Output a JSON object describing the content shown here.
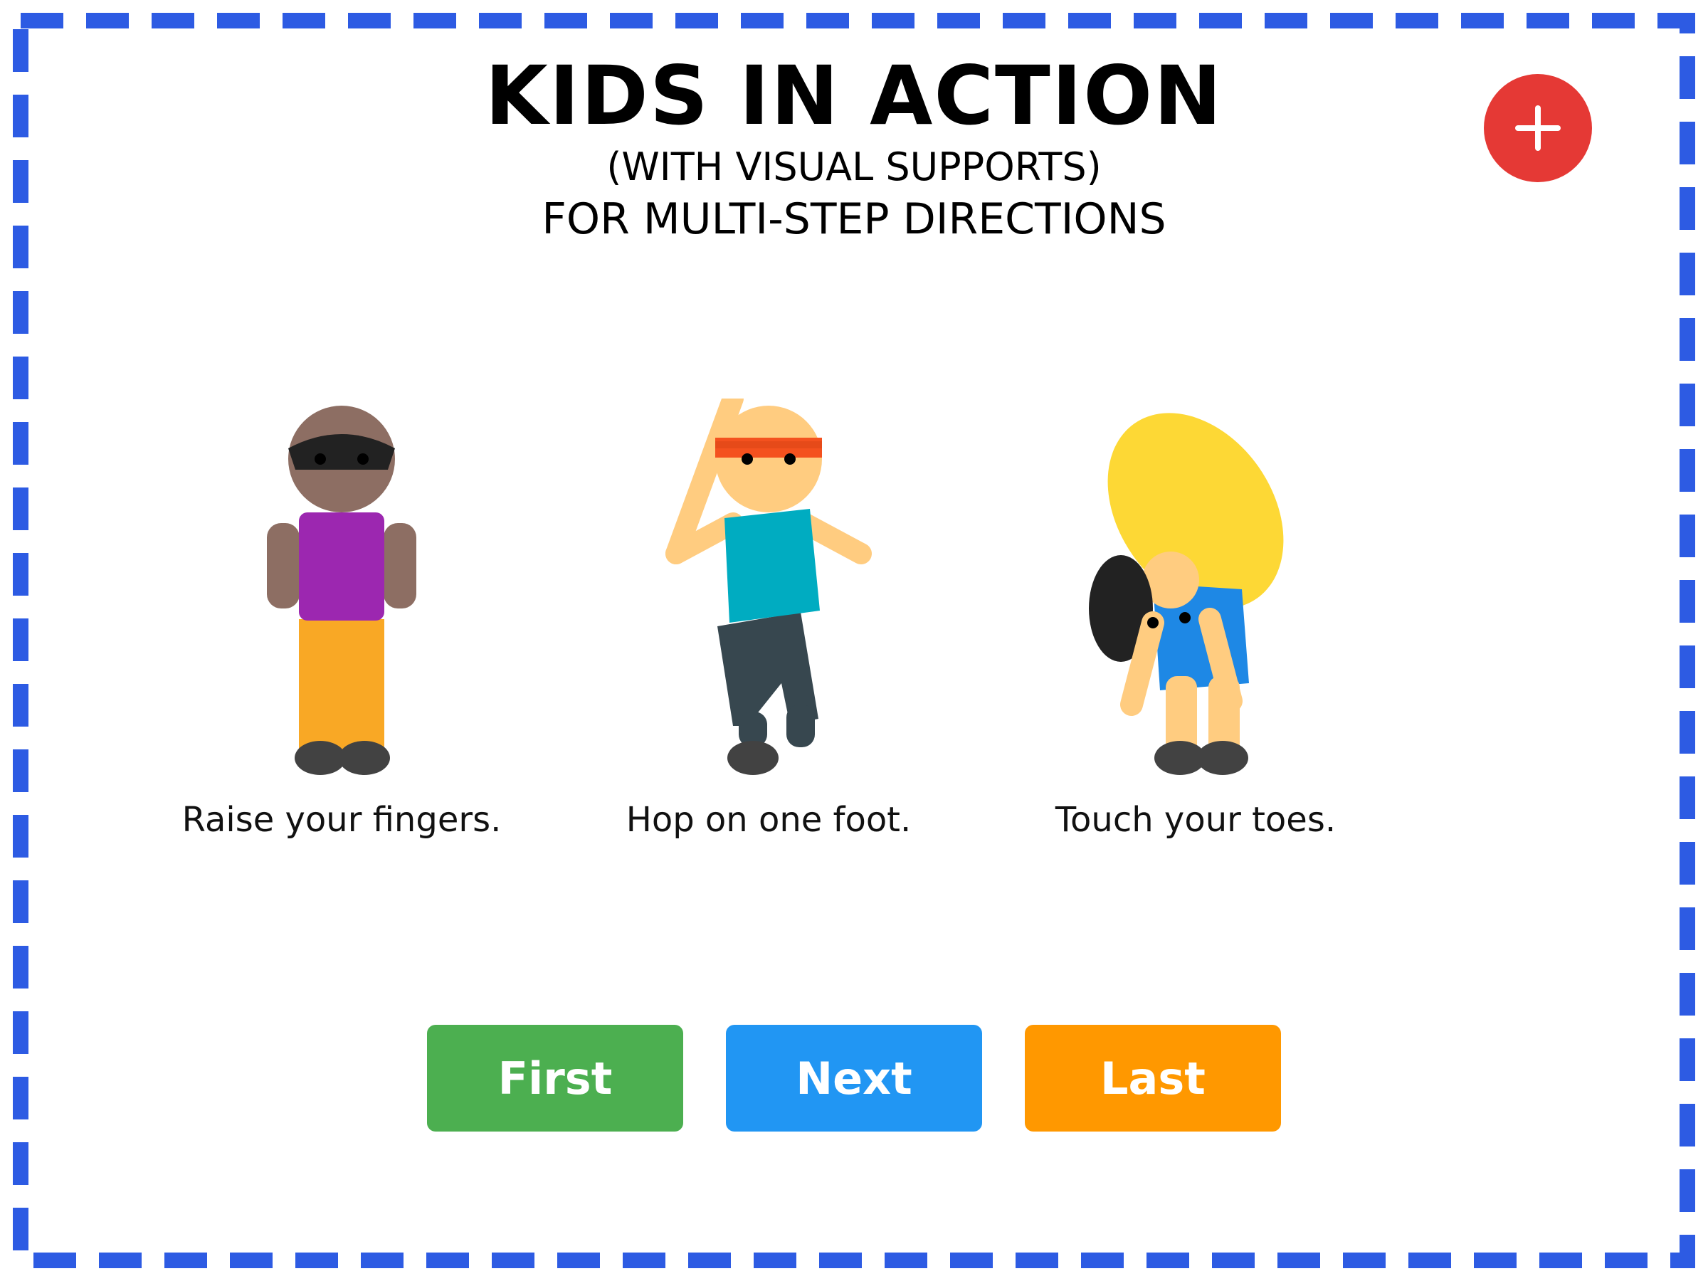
{
  "header": {
    "title": "KIDS IN ACTION",
    "subtitle_line1": "(WITH VISUAL SUPPORTS)",
    "subtitle_line2": "FOR MULTI-STEP DIRECTIONS"
  },
  "actions": [
    {
      "caption": "Raise your fingers."
    },
    {
      "caption": "Hop on one foot."
    },
    {
      "caption": "Touch your toes."
    }
  ],
  "navigation": {
    "first_label": "First",
    "next_label": "Next",
    "last_label": "Last"
  },
  "colors": {
    "border": "#2d5be3",
    "add_button": "#e53935",
    "first_button": "#4caf50",
    "next_button": "#2196f3",
    "last_button": "#ff9800"
  },
  "icons": {
    "add": "plus-icon"
  }
}
